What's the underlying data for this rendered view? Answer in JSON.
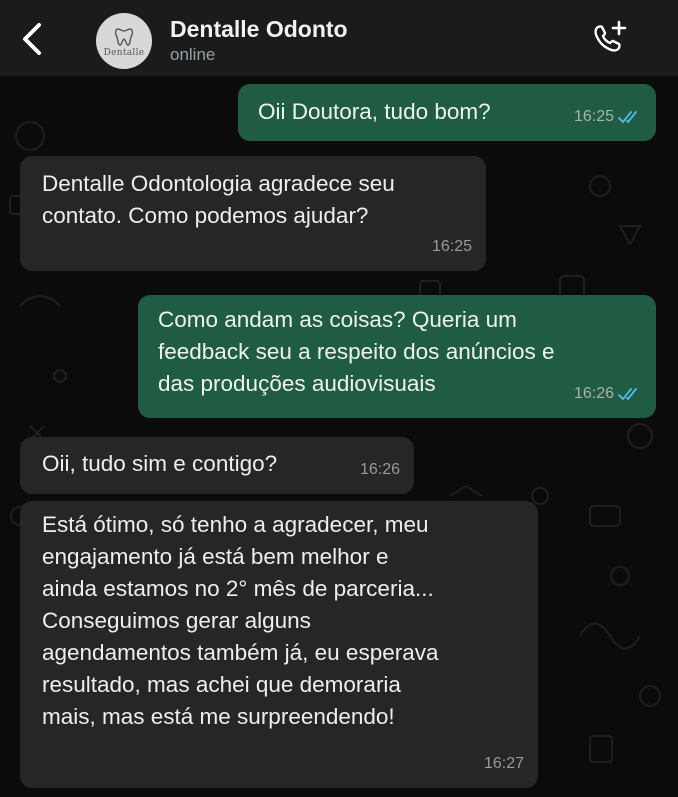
{
  "header": {
    "contact_name": "Dentalle Odonto",
    "status": "online",
    "avatar_text": "Dentalle",
    "back_icon": "chevron-left-icon",
    "call_icon": "add-call-icon"
  },
  "messages": [
    {
      "direction": "out",
      "text": "Oii Doutora, tudo bom?",
      "time": "16:25",
      "read": true
    },
    {
      "direction": "in",
      "text": "Dentalle Odontologia agradece seu\ncontato. Como podemos ajudar?",
      "time": "16:25"
    },
    {
      "direction": "out",
      "text": "Como andam as coisas? Queria um\nfeedback seu a respeito dos anúncios e\ndas produções audiovisuais",
      "time": "16:26",
      "read": true
    },
    {
      "direction": "in",
      "text": "Oii, tudo sim e contigo?",
      "time": "16:26"
    },
    {
      "direction": "in",
      "text": "Está ótimo, só tenho a agradecer, meu\nengajamento já está bem melhor e\nainda estamos no 2° mês de parceria...\nConseguimos gerar alguns\nagendamentos também já, eu esperava\nresultado, mas achei que demoraria\nmais, mas está me surpreendendo!",
      "time": "16:27"
    }
  ],
  "colors": {
    "outgoing_bubble": "#1f5c43",
    "incoming_bubble": "#262626",
    "read_ticks": "#53bdeb",
    "header_bg": "#1b1b1b"
  }
}
